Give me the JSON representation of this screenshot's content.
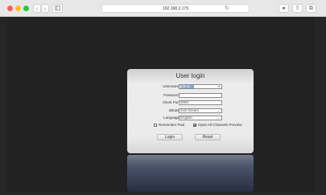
{
  "browser": {
    "url": "192.168.2.179",
    "back_icon": "chevron-left-icon",
    "forward_icon": "chevron-right-icon",
    "sidebar_icon": "sidebar-icon",
    "reload_icon": "reload-icon",
    "shield_icon": "shield-icon",
    "share_icon": "share-icon",
    "tabs_icon": "tabs-icon"
  },
  "login": {
    "title": "User login",
    "username_label": "Username",
    "username_value": "admin",
    "password_label": "Password",
    "password_value": "",
    "client_port_label": "Client Port",
    "client_port_value": "6000",
    "bitrate_label": "Bitrate",
    "bitrate_value": "Sub stream",
    "language_label": "Language",
    "language_value": "English",
    "remember_label": "Remember Pwd",
    "remember_checked": false,
    "preview_label": "Open All Channels Preview",
    "preview_checked": true,
    "login_button": "Login",
    "reset_button": "Reset"
  },
  "colors": {
    "close": "#fc5f57",
    "minimize": "#fdbc2e",
    "maximize": "#28c840",
    "background": "#262626"
  }
}
